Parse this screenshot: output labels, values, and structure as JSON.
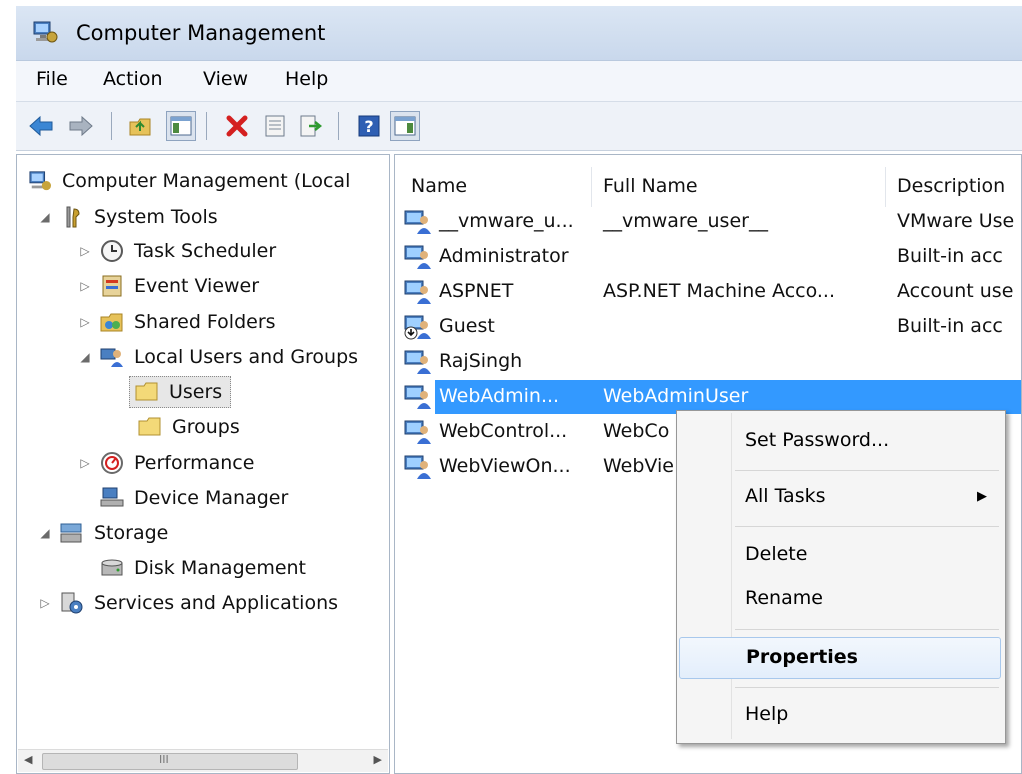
{
  "window": {
    "title": "Computer Management"
  },
  "menu": [
    "File",
    "Action",
    "View",
    "Help"
  ],
  "toolbar": [
    "back-icon",
    "forward-icon",
    "up-folder-icon",
    "show-hide-tree-icon",
    "delete-icon",
    "properties-icon",
    "export-icon",
    "help-icon",
    "show-hide-action-pane-icon"
  ],
  "tree": {
    "items": [
      {
        "label": "Computer Management (Local",
        "icon": "computer-management-icon",
        "expander": "none"
      },
      {
        "label": "System Tools",
        "icon": "system-tools-icon",
        "expander": "expanded"
      },
      {
        "label": "Task Scheduler",
        "icon": "clock-icon",
        "expander": "collapsed"
      },
      {
        "label": "Event Viewer",
        "icon": "event-viewer-icon",
        "expander": "collapsed"
      },
      {
        "label": "Shared Folders",
        "icon": "shared-folders-icon",
        "expander": "collapsed"
      },
      {
        "label": "Local Users and Groups",
        "icon": "users-icon",
        "expander": "expanded"
      },
      {
        "label": "Users",
        "icon": "folder-icon",
        "expander": "none",
        "selected": true
      },
      {
        "label": "Groups",
        "icon": "folder-icon",
        "expander": "none"
      },
      {
        "label": "Performance",
        "icon": "performance-icon",
        "expander": "collapsed"
      },
      {
        "label": "Device Manager",
        "icon": "device-manager-icon",
        "expander": "none"
      },
      {
        "label": "Storage",
        "icon": "storage-icon",
        "expander": "expanded"
      },
      {
        "label": "Disk Management",
        "icon": "disk-icon",
        "expander": "none"
      },
      {
        "label": "Services and Applications",
        "icon": "services-icon",
        "expander": "collapsed"
      }
    ],
    "scroll_grip": "III"
  },
  "list": {
    "columns": [
      "Name",
      "Full Name",
      "Description"
    ],
    "rows": [
      {
        "name": "__vmware_u...",
        "full_name": "__vmware_user__",
        "description": "VMware Use",
        "icon": "user-icon"
      },
      {
        "name": "Administrator",
        "full_name": "",
        "description": "Built-in acc",
        "icon": "user-icon"
      },
      {
        "name": "ASPNET",
        "full_name": "ASP.NET Machine Acco...",
        "description": "Account use",
        "icon": "user-icon"
      },
      {
        "name": "Guest",
        "full_name": "",
        "description": "Built-in acc",
        "icon": "disabled-user-icon"
      },
      {
        "name": "RajSingh",
        "full_name": "",
        "description": "",
        "icon": "user-icon"
      },
      {
        "name": "WebAdmin...",
        "full_name": "WebAdminUser",
        "description": "",
        "icon": "user-icon",
        "selected": true
      },
      {
        "name": "WebControl...",
        "full_name": "WebCo",
        "description": "",
        "icon": "user-icon"
      },
      {
        "name": "WebViewOn...",
        "full_name": "WebVie",
        "description": "",
        "icon": "user-icon"
      }
    ]
  },
  "context_menu": {
    "items": [
      {
        "label": "Set Password..."
      },
      {
        "label": "All Tasks",
        "submenu": true
      },
      {
        "label": "Delete"
      },
      {
        "label": "Rename"
      },
      {
        "label": "Properties",
        "bold": true,
        "highlighted": true
      },
      {
        "label": "Help"
      }
    ]
  },
  "colors": {
    "selection": "#3399ff",
    "titlebar": "#c9d8ec"
  }
}
